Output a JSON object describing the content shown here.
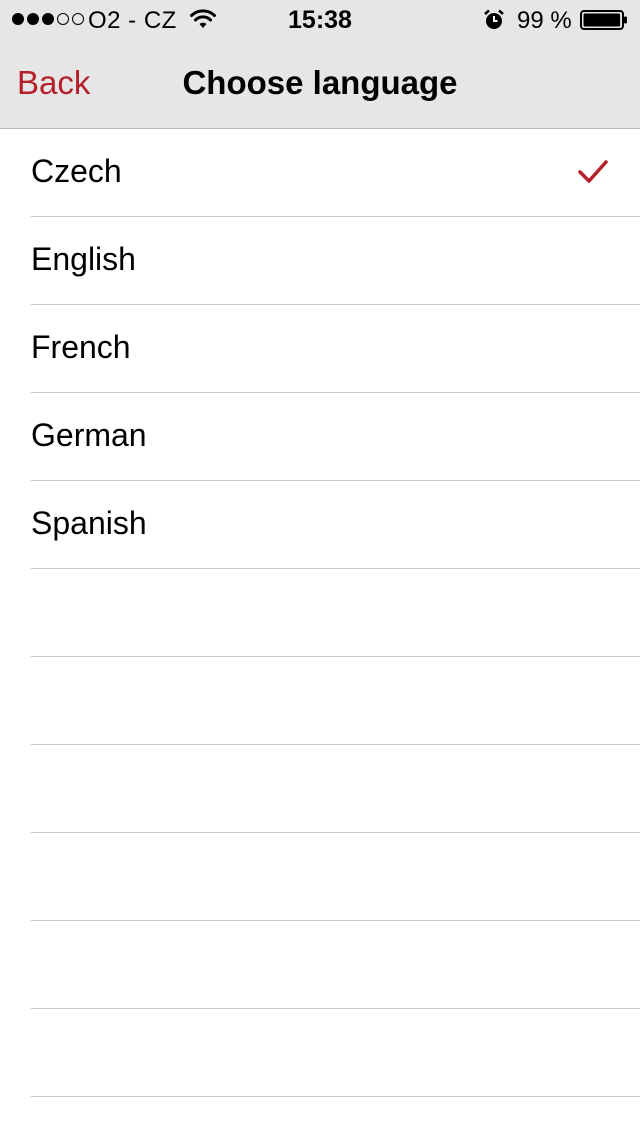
{
  "status_bar": {
    "signal_filled": 3,
    "signal_empty": 2,
    "carrier": "O2 - CZ",
    "time": "15:38",
    "battery_percent": "99 %",
    "battery_level": 0.99,
    "icons": [
      "signal-dots",
      "wifi-icon",
      "alarm-icon",
      "battery-icon"
    ]
  },
  "nav": {
    "back_label": "Back",
    "title": "Choose language"
  },
  "colors": {
    "accent": "#b5202a",
    "bar_background": "#e6e6e6",
    "separator": "#c8c7cc"
  },
  "languages": [
    {
      "label": "Czech",
      "selected": true
    },
    {
      "label": "English",
      "selected": false
    },
    {
      "label": "French",
      "selected": false
    },
    {
      "label": "German",
      "selected": false
    },
    {
      "label": "Spanish",
      "selected": false
    }
  ],
  "empty_rows": 6
}
